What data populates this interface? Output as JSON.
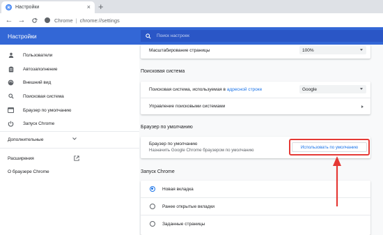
{
  "tab": {
    "title": "Настройки",
    "close": "×",
    "new_tab": "+"
  },
  "toolbar": {
    "back": "←",
    "forward": "→",
    "reload": "C",
    "origin": "Chrome",
    "separator": "|",
    "path": "chrome://settings"
  },
  "header": {
    "title": "Настройки",
    "search_placeholder": "Поиск настроек"
  },
  "sidebar": {
    "items": [
      {
        "label": "Пользователи",
        "icon": "person-icon"
      },
      {
        "label": "Автозаполнение",
        "icon": "clipboard-icon"
      },
      {
        "label": "Внешний вид",
        "icon": "palette-icon"
      },
      {
        "label": "Поисковая система",
        "icon": "search-icon"
      },
      {
        "label": "Браузер по умолчанию",
        "icon": "browser-icon"
      },
      {
        "label": "Запуск Chrome",
        "icon": "power-icon"
      }
    ],
    "advanced": "Дополнительные",
    "extensions": "Расширения",
    "about": "О браузере Chrome"
  },
  "main": {
    "zoom": {
      "label": "Масштабирование страницы",
      "value": "100%"
    },
    "search_section": {
      "title": "Поисковая система",
      "engine_label_prefix": "Поисковая система, используемая в ",
      "engine_link": "адресной строке",
      "engine_value": "Google",
      "manage_label": "Управление поисковыми системами"
    },
    "default_section": {
      "title": "Браузер по умолчанию",
      "row_title": "Браузер по умолчанию",
      "row_sub": "Назначить Google Chrome браузером по умолчанию",
      "button": "Использовать по умолчанию"
    },
    "startup_section": {
      "title": "Запуск Chrome",
      "options": [
        "Новая вкладка",
        "Ранее открытые вкладки",
        "Заданные страницы"
      ],
      "selected_index": 0
    }
  },
  "colors": {
    "header_blue": "#3367d6",
    "link_blue": "#1a73e8",
    "annotation_red": "#e53935"
  }
}
